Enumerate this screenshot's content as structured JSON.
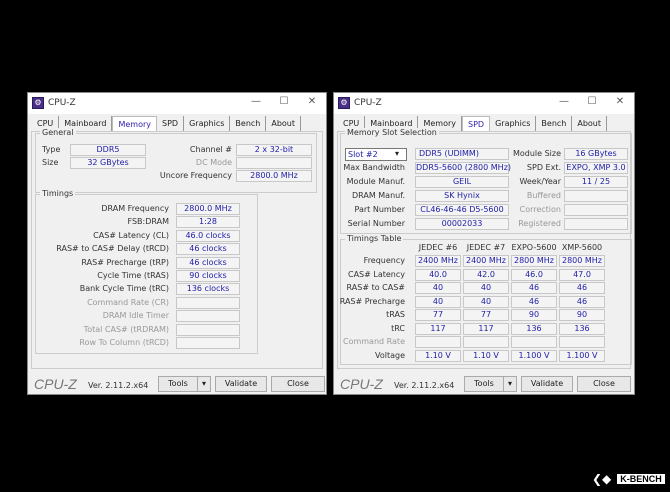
{
  "watermark": "K-BENCH",
  "left": {
    "title": "CPU-Z",
    "tabs": [
      "CPU",
      "Mainboard",
      "Memory",
      "SPD",
      "Graphics",
      "Bench",
      "About"
    ],
    "active_tab": "Memory",
    "general": {
      "title": "General",
      "type_label": "Type",
      "type": "DDR5",
      "size_label": "Size",
      "size": "32 GBytes",
      "channel_label": "Channel #",
      "channel": "2 x 32-bit",
      "dc_mode_label": "DC Mode",
      "dc_mode": "",
      "uncore_label": "Uncore Frequency",
      "uncore": "2800.0 MHz"
    },
    "timings": {
      "title": "Timings",
      "rows": [
        {
          "label": "DRAM Frequency",
          "value": "2800.0 MHz",
          "enabled": true
        },
        {
          "label": "FSB:DRAM",
          "value": "1:28",
          "enabled": true
        },
        {
          "label": "CAS# Latency (CL)",
          "value": "46.0 clocks",
          "enabled": true
        },
        {
          "label": "RAS# to CAS# Delay (tRCD)",
          "value": "46 clocks",
          "enabled": true
        },
        {
          "label": "RAS# Precharge (tRP)",
          "value": "46 clocks",
          "enabled": true
        },
        {
          "label": "Cycle Time (tRAS)",
          "value": "90 clocks",
          "enabled": true
        },
        {
          "label": "Bank Cycle Time (tRC)",
          "value": "136 clocks",
          "enabled": true
        },
        {
          "label": "Command Rate (CR)",
          "value": "",
          "enabled": false
        },
        {
          "label": "DRAM Idle Timer",
          "value": "",
          "enabled": false
        },
        {
          "label": "Total CAS# (tRDRAM)",
          "value": "",
          "enabled": false
        },
        {
          "label": "Row To Column (tRCD)",
          "value": "",
          "enabled": false
        }
      ]
    },
    "footer": {
      "logo": "CPU-Z",
      "version": "Ver. 2.11.2.x64",
      "tools": "Tools",
      "validate": "Validate",
      "close": "Close"
    }
  },
  "right": {
    "title": "CPU-Z",
    "tabs": [
      "CPU",
      "Mainboard",
      "Memory",
      "SPD",
      "Graphics",
      "Bench",
      "About"
    ],
    "active_tab": "SPD",
    "slot": {
      "title": "Memory Slot Selection",
      "selected": "Slot #2",
      "type": "DDR5 (UDIMM)",
      "left_rows": [
        {
          "label": "Max Bandwidth",
          "value": "DDR5-5600 (2800 MHz)"
        },
        {
          "label": "Module Manuf.",
          "value": "GEIL"
        },
        {
          "label": "DRAM Manuf.",
          "value": "SK Hynix"
        },
        {
          "label": "Part Number",
          "value": "CL46-46-46 D5-5600"
        },
        {
          "label": "Serial Number",
          "value": "00002033"
        }
      ],
      "right_rows": [
        {
          "label": "Module Size",
          "value": "16 GBytes",
          "enabled": true
        },
        {
          "label": "SPD Ext.",
          "value": "EXPO, XMP 3.0",
          "enabled": true
        },
        {
          "label": "Week/Year",
          "value": "11 / 25",
          "enabled": true
        },
        {
          "label": "Buffered",
          "value": "",
          "enabled": false
        },
        {
          "label": "Correction",
          "value": "",
          "enabled": false
        },
        {
          "label": "Registered",
          "value": "",
          "enabled": false
        }
      ]
    },
    "table": {
      "title": "Timings Table",
      "columns": [
        "JEDEC #6",
        "JEDEC #7",
        "EXPO-5600",
        "XMP-5600"
      ],
      "rows": [
        {
          "label": "Frequency",
          "values": [
            "2400 MHz",
            "2400 MHz",
            "2800 MHz",
            "2800 MHz"
          ],
          "enabled": true
        },
        {
          "label": "CAS# Latency",
          "values": [
            "40.0",
            "42.0",
            "46.0",
            "47.0"
          ],
          "enabled": true
        },
        {
          "label": "RAS# to CAS#",
          "values": [
            "40",
            "40",
            "46",
            "46"
          ],
          "enabled": true
        },
        {
          "label": "RAS# Precharge",
          "values": [
            "40",
            "40",
            "46",
            "46"
          ],
          "enabled": true
        },
        {
          "label": "tRAS",
          "values": [
            "77",
            "77",
            "90",
            "90"
          ],
          "enabled": true
        },
        {
          "label": "tRC",
          "values": [
            "117",
            "117",
            "136",
            "136"
          ],
          "enabled": true
        },
        {
          "label": "Command Rate",
          "values": [
            "",
            "",
            "",
            ""
          ],
          "enabled": false
        },
        {
          "label": "Voltage",
          "values": [
            "1.10 V",
            "1.10 V",
            "1.100 V",
            "1.100 V"
          ],
          "enabled": true
        }
      ]
    },
    "footer": {
      "logo": "CPU-Z",
      "version": "Ver. 2.11.2.x64",
      "tools": "Tools",
      "validate": "Validate",
      "close": "Close"
    }
  }
}
